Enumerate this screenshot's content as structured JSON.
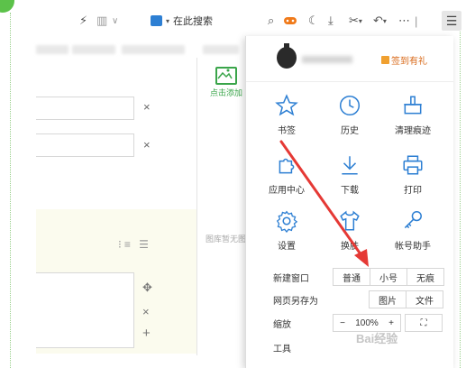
{
  "toolbar": {
    "search_text": "在此搜索"
  },
  "page": {
    "add_image_label": "点击添加",
    "empty_text": "图库暂无图"
  },
  "menu": {
    "signin_label": "签到有礼",
    "grid": [
      {
        "label": "书签",
        "icon": "star-icon"
      },
      {
        "label": "历史",
        "icon": "clock-icon"
      },
      {
        "label": "清理痕迹",
        "icon": "broom-icon"
      },
      {
        "label": "应用中心",
        "icon": "puzzle-icon"
      },
      {
        "label": "下载",
        "icon": "download-icon"
      },
      {
        "label": "打印",
        "icon": "printer-icon"
      },
      {
        "label": "设置",
        "icon": "gear-icon"
      },
      {
        "label": "换肤",
        "icon": "shirt-icon"
      },
      {
        "label": "帐号助手",
        "icon": "key-icon"
      }
    ],
    "new_window": {
      "label": "新建窗口",
      "options": [
        "普通",
        "小号",
        "无痕"
      ]
    },
    "save_page": {
      "label": "网页另存为",
      "options": [
        "图片",
        "文件"
      ]
    },
    "zoom": {
      "label": "缩放",
      "minus": "−",
      "value": "100%",
      "plus": "+"
    },
    "tools_label": "工具"
  },
  "colors": {
    "accent_green": "#3aa54a",
    "icon_blue": "#2d7fd3",
    "arrow_red": "#e53935",
    "signin_orange": "#d96a1a"
  }
}
